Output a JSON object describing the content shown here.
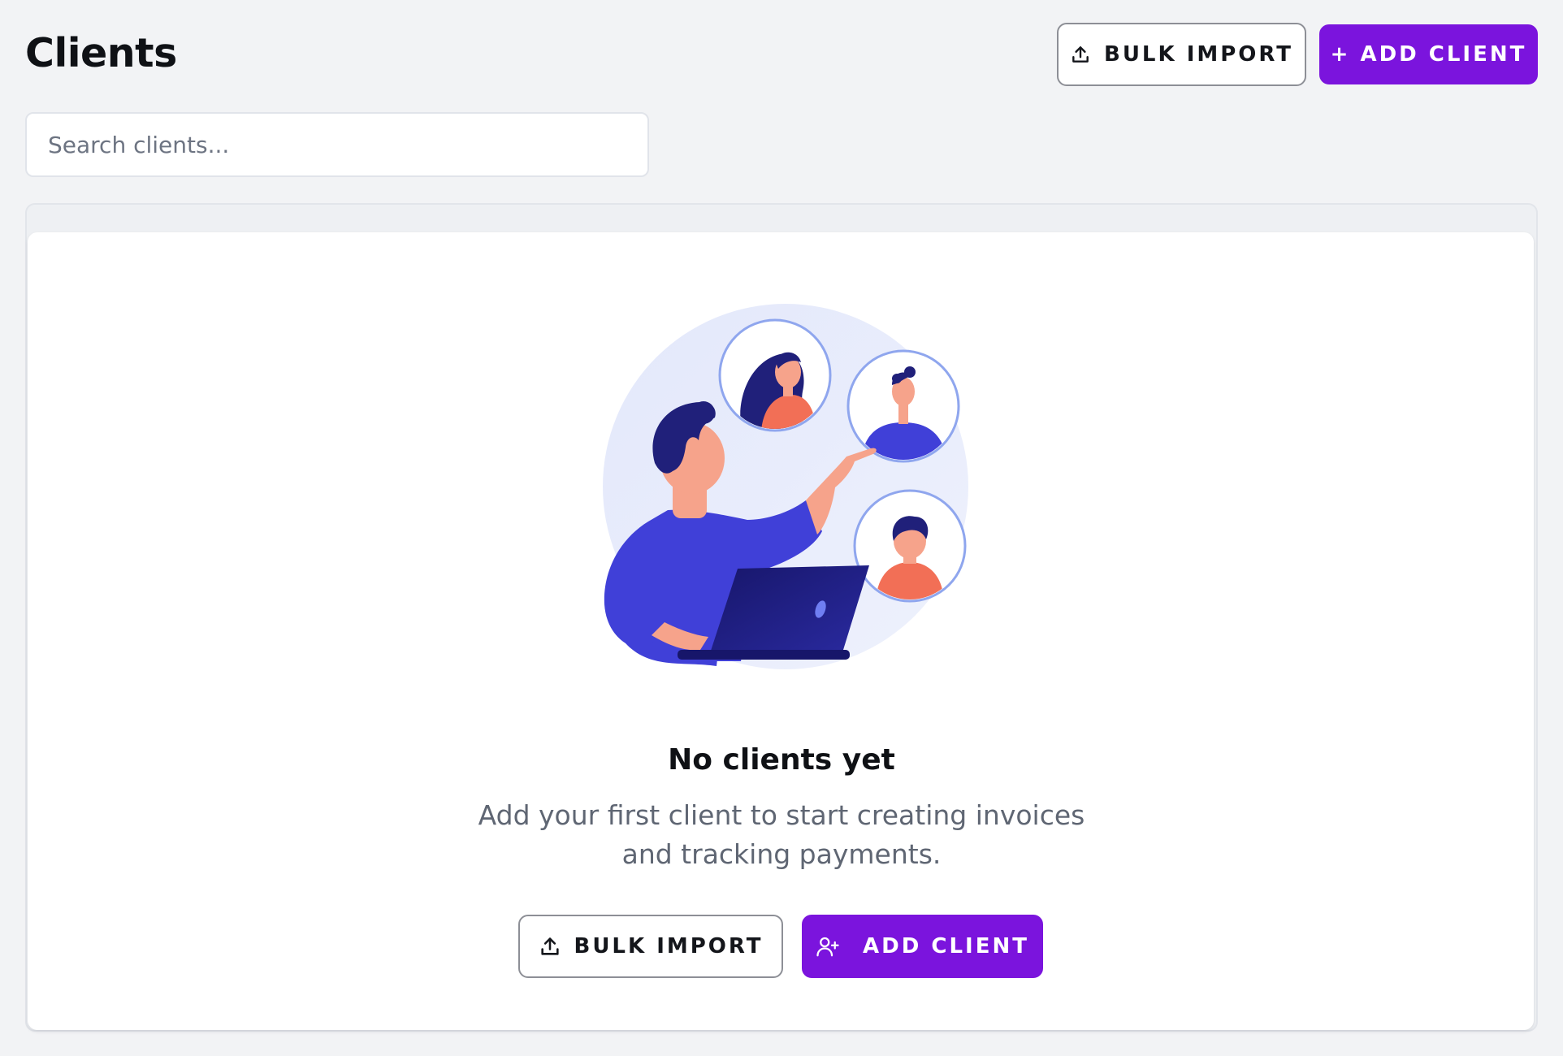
{
  "page": {
    "title": "Clients"
  },
  "header": {
    "bulk_import_label": "BULK IMPORT",
    "add_client_label": "+ ADD CLIENT"
  },
  "search": {
    "placeholder": "Search clients..."
  },
  "empty_state": {
    "title": "No clients yet",
    "description": "Add your first client to start creating invoices and tracking payments.",
    "bulk_import_label": "BULK IMPORT",
    "add_client_label": "ADD CLIENT",
    "illustration": "person-pointing-at-client-avatars-with-laptop"
  },
  "icons": {
    "upload": "upload-icon",
    "add_user": "user-plus-icon"
  },
  "colors": {
    "primary": "#7b14dd",
    "background": "#f2f3f5",
    "outline_border": "#8d8f96"
  }
}
